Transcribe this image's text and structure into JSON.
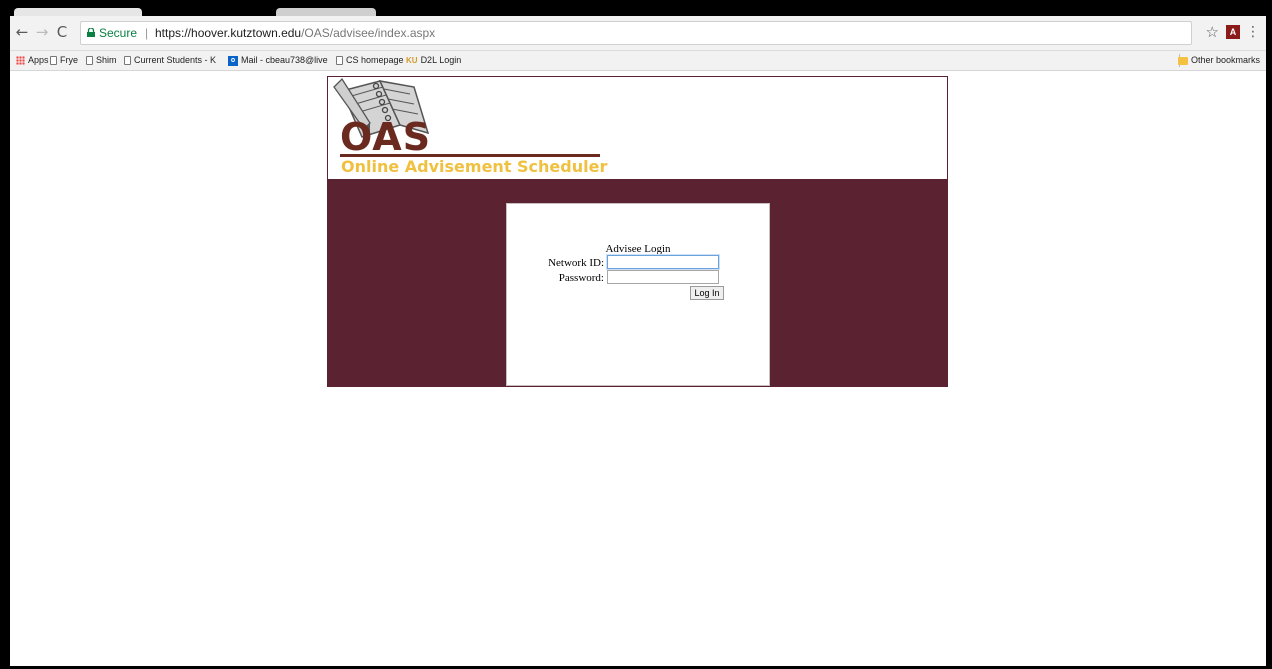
{
  "browser": {
    "secure_label": "Secure",
    "url_separator": "|",
    "url_host": "https://hoover.kutztown.edu",
    "url_path": "/OAS/advisee/index.aspx",
    "extension_label": "A"
  },
  "bookmarks": {
    "items": [
      {
        "label": "Apps",
        "icon": "apps-icon"
      },
      {
        "label": "Frye",
        "icon": "page-icon"
      },
      {
        "label": "Shim",
        "icon": "page-icon"
      },
      {
        "label": "Current Students - K",
        "icon": "page-icon"
      },
      {
        "label": "Mail - cbeau738@live",
        "icon": "outlook-icon"
      },
      {
        "label": "CS homepage",
        "icon": "page-icon"
      },
      {
        "label": "D2L Login",
        "icon": "ku-icon"
      }
    ],
    "other_label": "Other bookmarks"
  },
  "header": {
    "title": "OAS",
    "subtitle": "Online Advisement Scheduler"
  },
  "login": {
    "heading": "Advisee Login",
    "network_label": "Network ID:",
    "network_value": "",
    "password_label": "Password:",
    "password_value": "",
    "button_label": "Log In"
  },
  "colors": {
    "brand_maroon": "#5b2331",
    "title_brown": "#6b2a1f",
    "subtitle_gold": "#f0c040",
    "secure_green": "#0b8043"
  }
}
